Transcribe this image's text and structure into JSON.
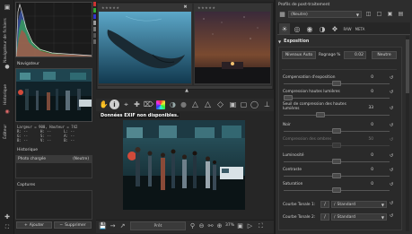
{
  "left": {
    "vtabs": [
      "Navigateur de fichiers",
      "Historique",
      "Captures",
      "Éditeur",
      "Navigateur"
    ],
    "navigator": {
      "title": "Navigateur",
      "info_line1": "Largeur = 900, Hauteur = 742",
      "info_r1": "R: --",
      "info_h1": "H: --",
      "info_l1": "L: --",
      "info_r2": "G: --",
      "info_h2": "S: --",
      "info_l2": "A: --",
      "info_r3": "B: --",
      "info_h3": "V: --",
      "info_l3": "B: --"
    },
    "history": {
      "title": "Historique",
      "item_label": "Photo chargée",
      "item_value": "(Neutre)"
    },
    "snapshots": {
      "title": "Captures",
      "add_label": "Ajouter",
      "delete_label": "Supprimer"
    }
  },
  "center": {
    "exif_message": "Données EXIF non disponibles.",
    "queue_label": "Prêt",
    "zoom_value": "37%",
    "toolbar_icons": [
      "hand-icon",
      "info-icon",
      "crop-icon",
      "straighten-icon",
      "color-picker-icon",
      "before-after-icon",
      "warning-high-icon",
      "warning-low-icon",
      "focus-mask-icon",
      "lock-icon",
      "clipping-icon",
      "rgb-icon",
      "preview-icon"
    ]
  },
  "right": {
    "profile_title": "Profils de post-traitement",
    "profile_value": "(Neutre)",
    "exposure": {
      "title": "Exposition",
      "auto_button": "Niveaux Auto",
      "clip_label": "Rognage %",
      "clip_value": "0.02",
      "neutral_button": "Neutre",
      "sliders": [
        {
          "label": "Compensation d'exposition",
          "value": "0",
          "knob": 0.5
        },
        {
          "label": "Compression hautes lumières",
          "value": "0",
          "knob": 0.0
        },
        {
          "label": "Seuil de compression des hautes lumières",
          "value": "33",
          "knob": 0.33
        },
        {
          "label": "Noir",
          "value": "0",
          "knob": 0.5
        },
        {
          "label": "Compression des ombres",
          "value": "50",
          "knob": 0.5,
          "disabled": true
        },
        {
          "label": "Luminosité",
          "value": "0",
          "knob": 0.5
        },
        {
          "label": "Contraste",
          "value": "0",
          "knob": 0.5
        },
        {
          "label": "Saturation",
          "value": "0",
          "knob": 0.5
        }
      ],
      "curve1_label": "Courbe Tonale 1:",
      "curve1_mode": "Standard",
      "curve2_label": "Courbe Tonale 2:",
      "curve2_mode": "Standard"
    }
  },
  "colors": {
    "accent_orange": "#f0a030",
    "panel_bg": "#2e2e2e",
    "app_bg": "#262626"
  }
}
